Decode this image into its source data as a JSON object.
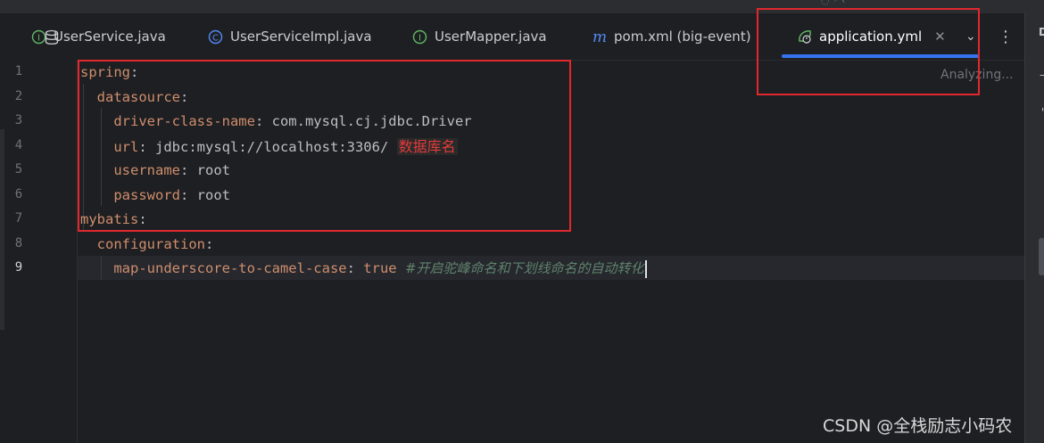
{
  "tabs": [
    {
      "label": "UserService.java",
      "icon": "interface-icon",
      "color": "#5fb865"
    },
    {
      "label": "UserServiceImpl.java",
      "icon": "class-icon",
      "color": "#548af7"
    },
    {
      "label": "UserMapper.java",
      "icon": "interface-icon",
      "color": "#5fb865"
    },
    {
      "label": "pom.xml (big-event)",
      "icon": "maven-icon",
      "color": "#548af7"
    },
    {
      "label": "application.yml",
      "icon": "spring-yml-icon",
      "color": "#5fb865",
      "active": true
    }
  ],
  "status": {
    "analyzing": "Analyzing..."
  },
  "line_numbers": [
    "1",
    "2",
    "3",
    "4",
    "5",
    "6",
    "7",
    "8",
    "9"
  ],
  "code": {
    "l1": {
      "key": "spring",
      "colon": ":"
    },
    "l2": {
      "key": "datasource",
      "colon": ":"
    },
    "l3": {
      "key": "driver-class-name",
      "colon": ": ",
      "value": "com.mysql.cj.jdbc.Driver"
    },
    "l4": {
      "key": "url",
      "colon": ": ",
      "value": "jdbc:mysql://localhost:3306/",
      "annotation": "数据库名"
    },
    "l5": {
      "key": "username",
      "colon": ": ",
      "value": "root"
    },
    "l6": {
      "key": "password",
      "colon": ": ",
      "value": "root"
    },
    "l7": {
      "key": "mybatis",
      "colon": ":"
    },
    "l8": {
      "key": "configuration",
      "colon": ":"
    },
    "l9": {
      "key": "map-underscore-to-camel-case",
      "colon": ": ",
      "value": "true",
      "comment": "#开启驼峰命名和下划线命名的自动转化"
    }
  },
  "watermark": "CSDN @全栈励志小码农",
  "colors": {
    "key": "#cf8e6d",
    "comment": "#5f826b",
    "accent": "#3574f0",
    "highlight_box": "#e0282e"
  }
}
